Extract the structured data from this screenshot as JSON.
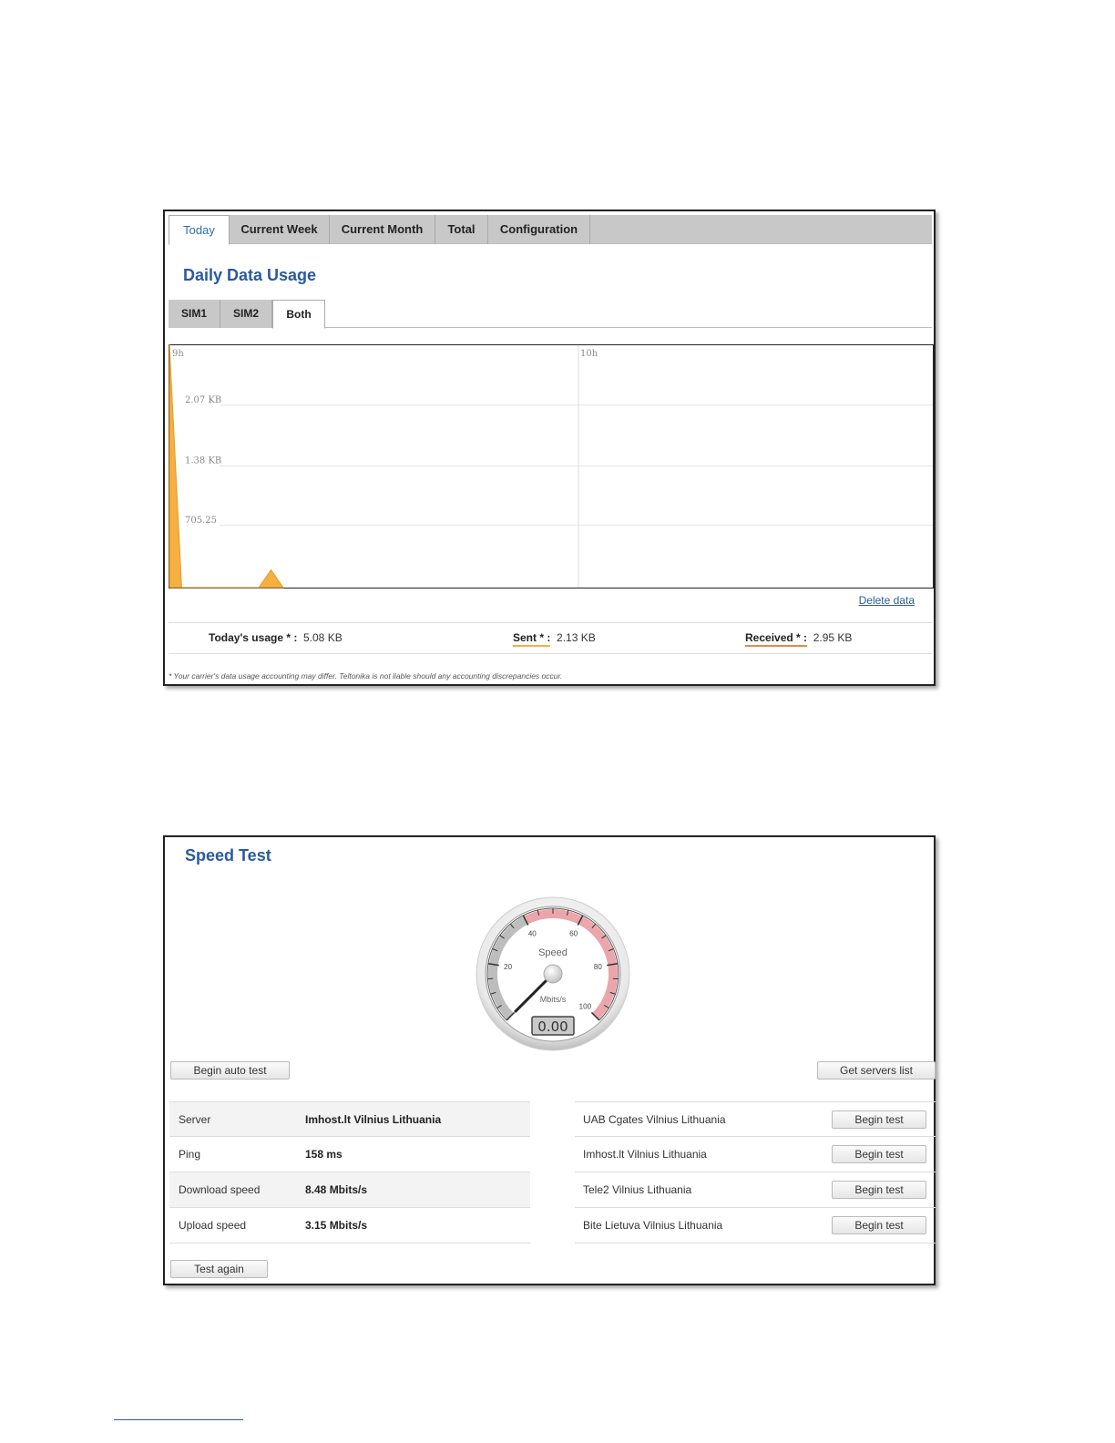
{
  "usage": {
    "tabs": [
      "Today",
      "Current Week",
      "Current Month",
      "Total",
      "Configuration"
    ],
    "active_tab": "Today",
    "title": "Daily Data Usage",
    "sim_tabs": [
      "SIM1",
      "SIM2",
      "Both"
    ],
    "active_sim_tab": "Both",
    "delete_label": "Delete data",
    "today_label": "Today's usage * :",
    "today_value": "5.08 KB",
    "sent_label": "Sent * :",
    "sent_value": "2.13 KB",
    "received_label": "Received * :",
    "received_value": "2.95 KB",
    "note": "* Your carrier's data usage accounting may differ. Teltonika is not liable should any accounting discrepancies occur."
  },
  "chart_data": {
    "type": "area",
    "x_ticks": [
      "9h",
      "10h"
    ],
    "y_ticks": [
      "2.07 KB",
      "1.38 KB",
      "705.25"
    ],
    "y_tick_values": [
      2070,
      1380,
      705.25
    ],
    "ylim": [
      0,
      2760
    ],
    "series": [
      {
        "color": "#f5b041",
        "x": [
          0,
          0.03,
          0.22,
          0.25,
          0.28
        ],
        "y": [
          2760,
          0,
          0,
          200,
          0
        ]
      }
    ]
  },
  "speed": {
    "title": "Speed Test",
    "gauge": {
      "label": "Speed",
      "unit": "Mbits/s",
      "value": "0.00",
      "ticks": [
        "20",
        "40",
        "60",
        "80",
        "100"
      ],
      "max": 100
    },
    "begin_auto_label": "Begin auto test",
    "get_servers_label": "Get servers list",
    "results": [
      {
        "key": "Server",
        "value": "Imhost.lt Vilnius Lithuania"
      },
      {
        "key": "Ping",
        "value": "158 ms"
      },
      {
        "key": "Download speed",
        "value": "8.48 Mbits/s"
      },
      {
        "key": "Upload speed",
        "value": "3.15 Mbits/s"
      }
    ],
    "servers": [
      {
        "name": "UAB Cgates Vilnius Lithuania",
        "button": "Begin test"
      },
      {
        "name": "Imhost.lt Vilnius Lithuania",
        "button": "Begin test"
      },
      {
        "name": "Tele2 Vilnius Lithuania",
        "button": "Begin test"
      },
      {
        "name": "Bite Lietuva Vilnius Lithuania",
        "button": "Begin test"
      }
    ],
    "test_again_label": "Test again"
  }
}
